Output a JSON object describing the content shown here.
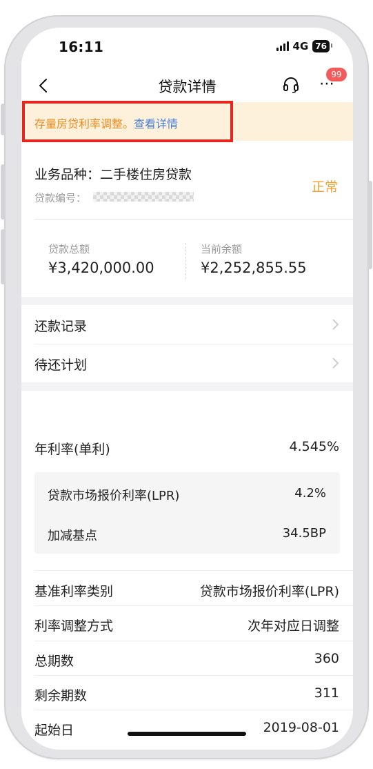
{
  "status_bar": {
    "time": "16:11",
    "network": "4G",
    "battery": "76"
  },
  "nav": {
    "title": "贷款详情",
    "badge": "99",
    "more": "⋯"
  },
  "notice": {
    "text": "存量房贷利率调整。",
    "link": "查看详情"
  },
  "loan": {
    "product_label": "业务品种：",
    "product_value": "二手楼住房贷款",
    "loan_no_label": "贷款编号：",
    "status": "正常",
    "total_label": "贷款总额",
    "total_value": "¥3,420,000.00",
    "balance_label": "当前余额",
    "balance_value": "¥2,252,855.55"
  },
  "menu": [
    {
      "label": "还款记录"
    },
    {
      "label": "待还计划"
    }
  ],
  "rate": {
    "annual_label": "年利率(单利)",
    "annual_value": "4.545%",
    "lpr_label": "贷款市场报价利率(LPR)",
    "lpr_value": "4.2%",
    "bp_label": "加减基点",
    "bp_value": "34.5BP"
  },
  "details": [
    {
      "label": "基准利率类别",
      "value": "贷款市场报价利率(LPR)"
    },
    {
      "label": "利率调整方式",
      "value": "次年对应日调整"
    },
    {
      "label": "总期数",
      "value": "360"
    },
    {
      "label": "剩余期数",
      "value": "311"
    },
    {
      "label": "起始日",
      "value": "2019-08-01"
    }
  ],
  "colors": {
    "notice_bg": "#fdf1dc",
    "notice_text": "#ee8a1d",
    "link": "#4a7fd6",
    "status": "#f2a033",
    "highlight": "#e5261f",
    "badge": "#f15b5b"
  }
}
